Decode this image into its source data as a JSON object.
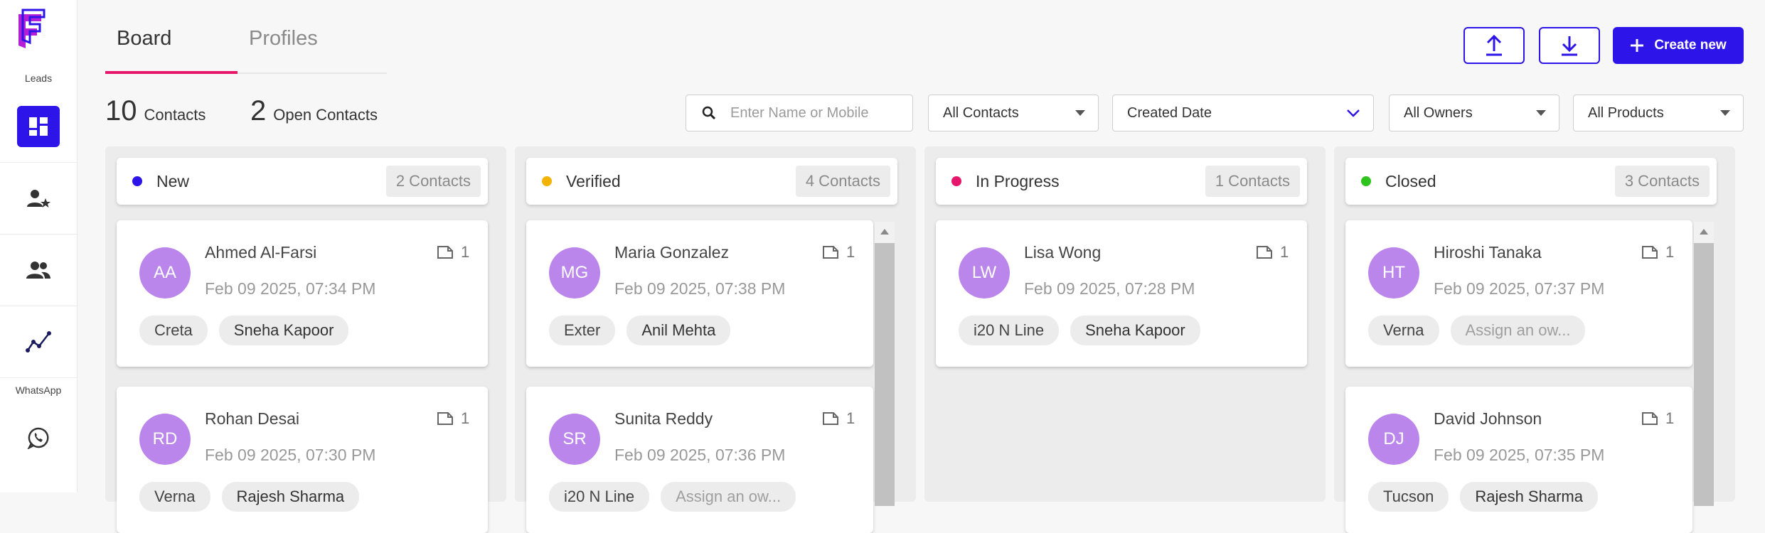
{
  "sidebar": {
    "logo_alt": "F",
    "leads_label": "Leads",
    "whatsapp_label": "WhatsApp",
    "items": [
      {
        "icon": "dashboard-icon"
      },
      {
        "icon": "contacts-star-icon"
      },
      {
        "icon": "team-icon"
      },
      {
        "icon": "analytics-icon"
      },
      {
        "icon": "whatsapp-icon"
      }
    ]
  },
  "tabs": [
    {
      "label": "Board",
      "active": true
    },
    {
      "label": "Profiles",
      "active": false
    }
  ],
  "header": {
    "upload_icon": "upload-icon",
    "download_icon": "download-icon",
    "create_label": "Create new"
  },
  "counts": {
    "contacts_num": "10",
    "contacts_label": "Contacts",
    "open_num": "2",
    "open_label": "Open Contacts"
  },
  "filters": {
    "search_placeholder": "Enter Name or Mobile",
    "contacts_filter": "All Contacts",
    "date_filter": "Created Date",
    "owners_filter": "All Owners",
    "products_filter": "All Products"
  },
  "colors": {
    "accent": "#2d14e8",
    "tab_underline": "#e6166b",
    "avatar": "#bb86ec",
    "new": "#2d14e8",
    "verified": "#f5b301",
    "in_progress": "#e6166b",
    "closed": "#2ec31d"
  },
  "columns": [
    {
      "title": "New",
      "count": "2 Contacts",
      "cards": [
        {
          "initials": "AA",
          "name": "Ahmed Al-Farsi",
          "date": "Feb 09 2025, 07:34 PM",
          "notes": "1",
          "product": "Creta",
          "owner": "Sneha Kapoor"
        },
        {
          "initials": "RD",
          "name": "Rohan Desai",
          "date": "Feb 09 2025, 07:30 PM",
          "notes": "1",
          "product": "Verna",
          "owner": "Rajesh Sharma"
        }
      ]
    },
    {
      "title": "Verified",
      "count": "4 Contacts",
      "cards": [
        {
          "initials": "MG",
          "name": "Maria Gonzalez",
          "date": "Feb 09 2025, 07:38 PM",
          "notes": "1",
          "product": "Exter",
          "owner": "Anil Mehta"
        },
        {
          "initials": "SR",
          "name": "Sunita Reddy",
          "date": "Feb 09 2025, 07:36 PM",
          "notes": "1",
          "product": "i20 N Line",
          "owner": "Assign an ow..."
        }
      ]
    },
    {
      "title": "In Progress",
      "count": "1 Contacts",
      "cards": [
        {
          "initials": "LW",
          "name": "Lisa Wong",
          "date": "Feb 09 2025, 07:28 PM",
          "notes": "1",
          "product": "i20 N Line",
          "owner": "Sneha Kapoor"
        }
      ]
    },
    {
      "title": "Closed",
      "count": "3 Contacts",
      "cards": [
        {
          "initials": "HT",
          "name": "Hiroshi Tanaka",
          "date": "Feb 09 2025, 07:37 PM",
          "notes": "1",
          "product": "Verna",
          "owner": "Assign an ow..."
        },
        {
          "initials": "DJ",
          "name": "David Johnson",
          "date": "Feb 09 2025, 07:35 PM",
          "notes": "1",
          "product": "Tucson",
          "owner": "Rajesh Sharma"
        }
      ]
    }
  ]
}
